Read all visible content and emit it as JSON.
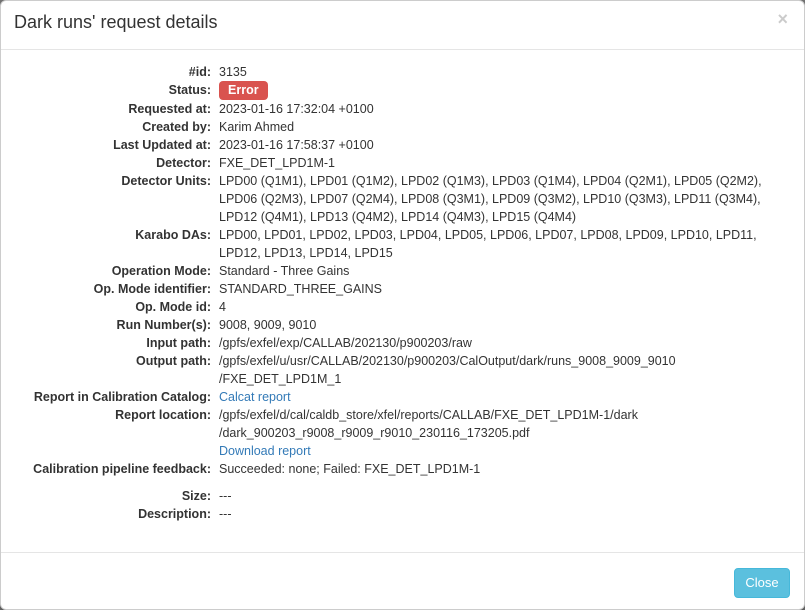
{
  "modal": {
    "title": "Dark runs' request details",
    "close_symbol": "×",
    "close_button_label": "Close"
  },
  "colors": {
    "error_badge": "#d9534f",
    "link": "#337ab7",
    "info_button": "#5bc0de"
  },
  "details": {
    "id_label": "#id:",
    "id_value": "3135",
    "status_label": "Status:",
    "status_value": "Error",
    "requested_label": "Requested at:",
    "requested_value": "2023-01-16 17:32:04 +0100",
    "created_by_label": "Created by:",
    "created_by_value": "Karim Ahmed",
    "last_updated_label": "Last Updated at:",
    "last_updated_value": "2023-01-16 17:58:37 +0100",
    "detector_label": "Detector:",
    "detector_value": "FXE_DET_LPD1M-1",
    "detector_units_label": "Detector Units:",
    "detector_units_lines": [
      "LPD00 (Q1M1), LPD01 (Q1M2), LPD02 (Q1M3), LPD03 (Q1M4), LPD04 (Q2M1), LPD05 (Q2M2),",
      "LPD06 (Q2M3), LPD07 (Q2M4), LPD08 (Q3M1), LPD09 (Q3M2), LPD10 (Q3M3), LPD11 (Q3M4),",
      "LPD12 (Q4M1), LPD13 (Q4M2), LPD14 (Q4M3), LPD15 (Q4M4)"
    ],
    "karabo_das_label": "Karabo DAs:",
    "karabo_das_lines": [
      "LPD00, LPD01, LPD02, LPD03, LPD04, LPD05, LPD06, LPD07, LPD08, LPD09, LPD10, LPD11,",
      "LPD12, LPD13, LPD14, LPD15"
    ],
    "operation_mode_label": "Operation Mode:",
    "operation_mode_value": "Standard - Three Gains",
    "op_mode_identifier_label": "Op. Mode identifier:",
    "op_mode_identifier_value": "STANDARD_THREE_GAINS",
    "op_mode_id_label": "Op. Mode id:",
    "op_mode_id_value": "4",
    "run_numbers_label": "Run Number(s):",
    "run_numbers_value": "9008, 9009, 9010",
    "input_path_label": "Input path:",
    "input_path_value": "/gpfs/exfel/exp/CALLAB/202130/p900203/raw",
    "output_path_label": "Output path:",
    "output_path_lines": [
      "/gpfs/exfel/u/usr/CALLAB/202130/p900203/CalOutput/dark/runs_9008_9009_9010",
      "/FXE_DET_LPD1M_1"
    ],
    "report_catalog_label": "Report in Calibration Catalog:",
    "report_catalog_link": "Calcat report",
    "report_location_label": "Report location:",
    "report_location_lines": [
      "/gpfs/exfel/d/cal/caldb_store/xfel/reports/CALLAB/FXE_DET_LPD1M-1/dark",
      "/dark_900203_r9008_r9009_r9010_230116_173205.pdf"
    ],
    "download_report_link": "Download report",
    "feedback_label": "Calibration pipeline feedback:",
    "feedback_value": "Succeeded: none; Failed: FXE_DET_LPD1M-1",
    "size_label": "Size:",
    "size_value": "---",
    "description_label": "Description:",
    "description_value": "---"
  }
}
